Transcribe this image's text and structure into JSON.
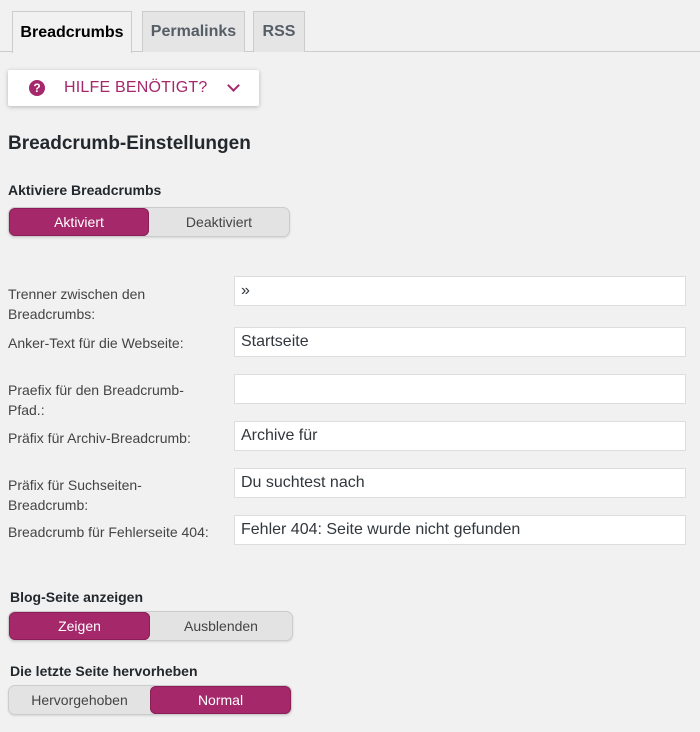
{
  "tabs": [
    {
      "label": "Breadcrumbs",
      "active": true
    },
    {
      "label": "Permalinks",
      "active": false
    },
    {
      "label": "RSS",
      "active": false
    }
  ],
  "help": {
    "icon": "question-circle-icon",
    "label": "HILFE BENÖTIGT?",
    "chevron": "chevron-down-icon"
  },
  "section_title": "Breadcrumb-Einstellungen",
  "enable": {
    "label": "Aktiviere Breadcrumbs",
    "options": [
      "Aktiviert",
      "Deaktiviert"
    ],
    "selected": "Aktiviert"
  },
  "fields": [
    {
      "label": "Trenner zwischen den Breadcrumbs:",
      "value": "»"
    },
    {
      "label": "Anker-Text für die Webseite:",
      "value": "Startseite"
    },
    {
      "label": "Praefix für den Breadcrumb-Pfad.:",
      "value": ""
    },
    {
      "label": "Präfix für Archiv-Breadcrumb:",
      "value": "Archive für"
    },
    {
      "label": "Präfix für Suchseiten-Breadcrumb:",
      "value": "Du suchtest nach"
    },
    {
      "label": "Breadcrumb für Fehlerseite 404:",
      "value": "Fehler 404: Seite wurde nicht gefunden"
    }
  ],
  "blog_page": {
    "label": "Blog-Seite anzeigen",
    "options": [
      "Zeigen",
      "Ausblenden"
    ],
    "selected": "Zeigen"
  },
  "last_page": {
    "label": "Die letzte Seite hervorheben",
    "options": [
      "Hervorgehoben",
      "Normal"
    ],
    "selected": "Normal"
  },
  "colors": {
    "accent": "#a4286a",
    "background": "#f1f1f1"
  }
}
